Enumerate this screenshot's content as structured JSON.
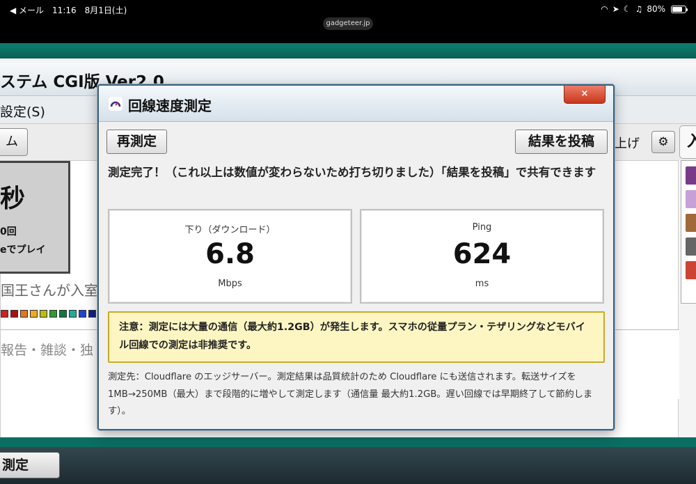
{
  "statusbar": {
    "back_app": "◀ メール",
    "time": "11:16",
    "date": "8月1日(土)",
    "battery": "80%",
    "battery_level": 0.8,
    "url": "gadgeteer.jp"
  },
  "background": {
    "title": "ステム CGI版 Ver2.0",
    "menu_settings": "設定(S)",
    "toolbar_button": "ム",
    "raise_label": "上げ",
    "right_panel_label": "入",
    "sec_big": "秒",
    "sec_line1": "0回",
    "sec_line2": "eでプレイ",
    "entered_msg": "国王さんが入室",
    "chat_placeholder": "報告・雑談・独",
    "footer_button": "測定",
    "swatches": [
      "#cc2222",
      "#aa1111",
      "#dd7722",
      "#eeaa22",
      "#bbbb11",
      "#339933",
      "#117744",
      "#22aa99",
      "#2244cc",
      "#112288"
    ],
    "avatars": [
      "#7a3a8a",
      "#c8a0d8",
      "#a06a3a",
      "#666666",
      "#cc4433"
    ]
  },
  "dialog": {
    "title": "回線速度測定",
    "close_label": "×",
    "retest_label": "再測定",
    "post_label": "結果を投稿",
    "done_message": "測定完了！（これ以上は数値が変わらないため打ち切りました）「結果を投稿」で共有できます",
    "download": {
      "label": "下り（ダウンロード）",
      "value": "6.8",
      "unit": "Mbps"
    },
    "ping": {
      "label": "Ping",
      "value": "624",
      "unit": "ms"
    },
    "warning": "注意：測定には大量の通信（最大約1.2GB）が発生します。スマホの従量プラン・テザリングなどモバイル回線での測定は非推奨です。",
    "note": "測定先：Cloudflare のエッジサーバー。測定結果は品質統計のため Cloudflare にも送信されます。転送サイズを1MB→250MB（最大）まで段階的に増やして測定します（通信量 最大約1.2GB。遅い回線では早期終了して節約します）。"
  },
  "colors": {
    "teal": "#0b6e62",
    "close_red": "#c8371c",
    "warn_bg": "#fdf6c3",
    "warn_border": "#c9aa22",
    "icon_purple": "#3b2a8f"
  }
}
